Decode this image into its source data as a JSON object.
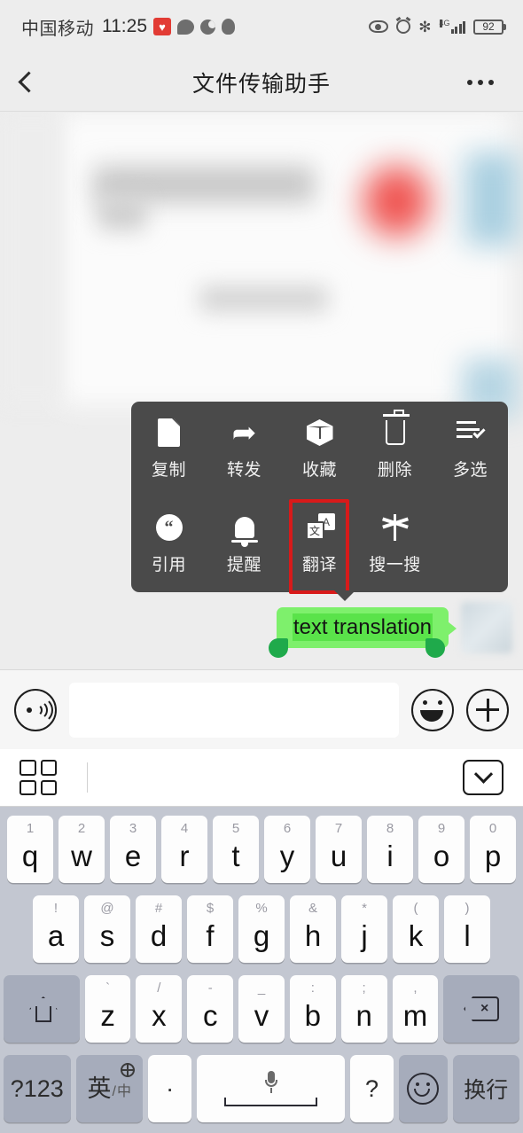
{
  "status_bar": {
    "carrier": "中国移动",
    "time": "11:25",
    "battery": "92",
    "network": "4G",
    "icons": [
      "red-badge-icon",
      "chat-bubble-icon",
      "moon-icon",
      "person-icon",
      "eye-icon",
      "alarm-icon",
      "bluetooth-icon",
      "signal-icon",
      "battery-icon"
    ],
    "bluetooth_glyph": "✻"
  },
  "nav": {
    "title": "文件传输助手",
    "back_icon": "chevron-left-icon",
    "more_icon": "more-dots-icon"
  },
  "context_menu": {
    "row1": [
      {
        "label": "复制",
        "icon": "document-copy-icon"
      },
      {
        "label": "转发",
        "icon": "forward-arrow-icon"
      },
      {
        "label": "收藏",
        "icon": "box-favorite-icon"
      },
      {
        "label": "删除",
        "icon": "trash-icon"
      },
      {
        "label": "多选",
        "icon": "multi-select-icon"
      }
    ],
    "row2": [
      {
        "label": "引用",
        "icon": "quote-icon",
        "highlighted": false
      },
      {
        "label": "提醒",
        "icon": "bell-icon",
        "highlighted": false
      },
      {
        "label": "翻译",
        "icon": "translate-icon",
        "highlighted": true
      },
      {
        "label": "搜一搜",
        "icon": "search-sparkle-icon",
        "highlighted": false
      }
    ],
    "translate_icon_chars": {
      "source": "文",
      "target": "A"
    },
    "highlight_color": "#d81a1a",
    "background_color": "#4a4a4a"
  },
  "message": {
    "text": "text translation",
    "bubble_color": "#7ef06c",
    "selection_color": "#5ae34a",
    "handle_color": "#1faa4b"
  },
  "input_bar": {
    "voice_icon": "voice-record-icon",
    "text_value": "",
    "text_placeholder": "",
    "emoji_icon": "emoji-smiley-icon",
    "plus_icon": "plus-circle-icon"
  },
  "keyboard_toolbar": {
    "grid_icon": "grid-panel-icon",
    "collapse_icon": "chevron-down-icon"
  },
  "keyboard": {
    "row1": [
      {
        "main": "q",
        "sup": "1"
      },
      {
        "main": "w",
        "sup": "2"
      },
      {
        "main": "e",
        "sup": "3"
      },
      {
        "main": "r",
        "sup": "4"
      },
      {
        "main": "t",
        "sup": "5"
      },
      {
        "main": "y",
        "sup": "6"
      },
      {
        "main": "u",
        "sup": "7"
      },
      {
        "main": "i",
        "sup": "8"
      },
      {
        "main": "o",
        "sup": "9"
      },
      {
        "main": "p",
        "sup": "0"
      }
    ],
    "row2": [
      {
        "main": "a",
        "sup": "!"
      },
      {
        "main": "s",
        "sup": "@"
      },
      {
        "main": "d",
        "sup": "#"
      },
      {
        "main": "f",
        "sup": "$"
      },
      {
        "main": "g",
        "sup": "%"
      },
      {
        "main": "h",
        "sup": "&"
      },
      {
        "main": "j",
        "sup": "*"
      },
      {
        "main": "k",
        "sup": "("
      },
      {
        "main": "l",
        "sup": ")"
      }
    ],
    "row3": {
      "shift_icon": "shift-arrow-icon",
      "letters": [
        {
          "main": "z",
          "sup": "`"
        },
        {
          "main": "x",
          "sup": "/"
        },
        {
          "main": "c",
          "sup": "-"
        },
        {
          "main": "v",
          "sup": "_"
        },
        {
          "main": "b",
          "sup": ":"
        },
        {
          "main": "n",
          "sup": ";"
        },
        {
          "main": "m",
          "sup": ","
        }
      ],
      "backspace_icon": "backspace-icon",
      "backspace_glyph": "×"
    },
    "row4": {
      "symbols_label": "?123",
      "lang_zh": "英",
      "lang_slash": "/",
      "lang_cn": "中",
      "globe_icon": "globe-icon",
      "period": "·",
      "space_icon": "microphone-icon",
      "question": "?",
      "smiley_icon": "smiley-face-icon",
      "enter_label": "换行"
    }
  }
}
